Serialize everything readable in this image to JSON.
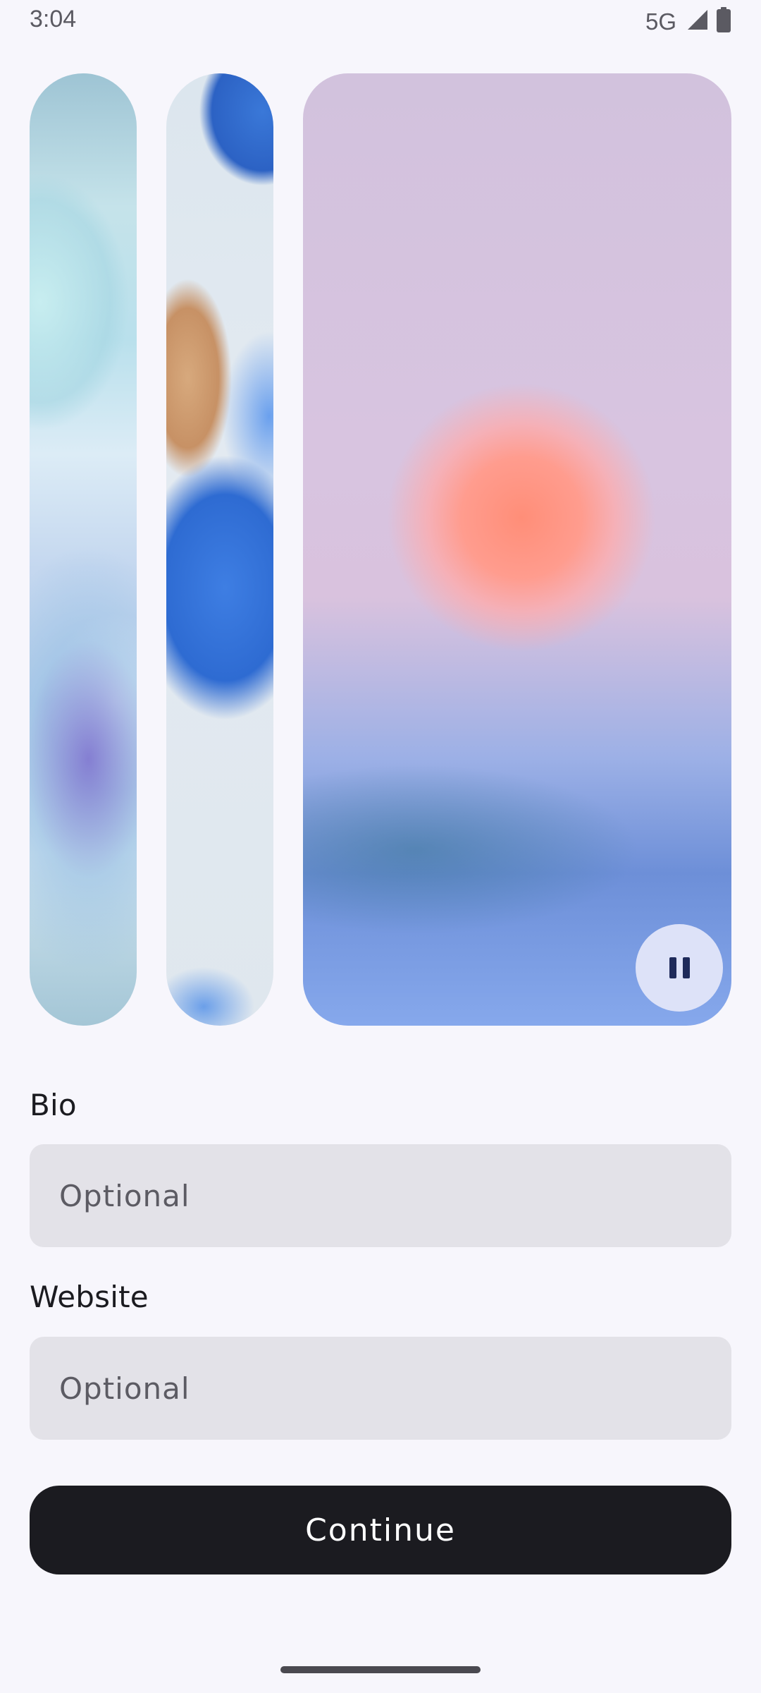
{
  "status_bar": {
    "time": "3:04",
    "network": "5G",
    "icons": [
      "signal-icon",
      "battery-icon"
    ]
  },
  "carousel": {
    "panels": [
      {
        "description_icon": "wallpaper-thumbnail",
        "style": "blue-bubbles"
      },
      {
        "description_icon": "wallpaper-thumbnail",
        "style": "blue-shapes"
      },
      {
        "description_icon": "wallpaper-thumbnail",
        "style": "sunset-gradient"
      }
    ],
    "pause_icon": "pause-icon"
  },
  "form": {
    "bio_label": "Bio",
    "bio_placeholder": "Optional",
    "bio_value": "",
    "website_label": "Website",
    "website_placeholder": "Optional",
    "website_value": ""
  },
  "actions": {
    "continue_label": "Continue"
  },
  "colors": {
    "background": "#f7f6fc",
    "field_background": "#e3e2e8",
    "button_background": "#1b1b20",
    "button_text": "#ffffff",
    "pause_button_background": "#dde2f8"
  }
}
